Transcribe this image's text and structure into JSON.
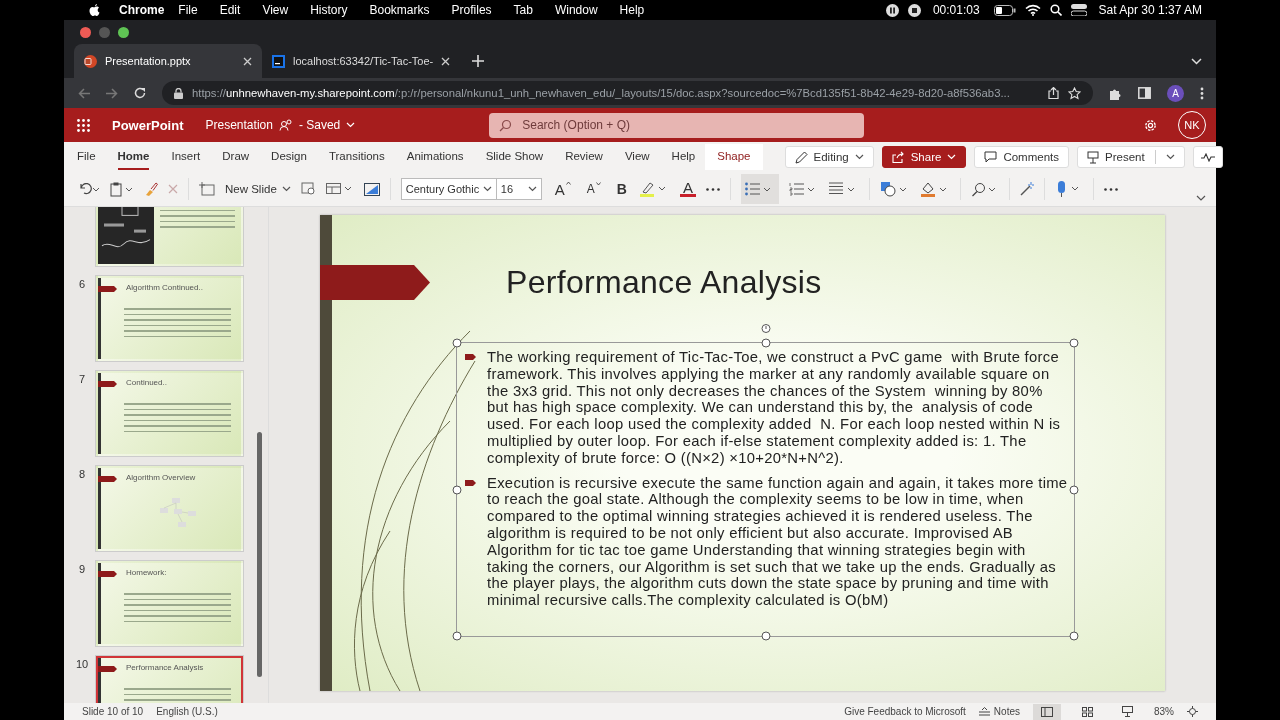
{
  "menubar": {
    "app": "Chrome",
    "menus": [
      "File",
      "Edit",
      "View",
      "History",
      "Bookmarks",
      "Profiles",
      "Tab",
      "Window",
      "Help"
    ],
    "recording_time": "00:01:03",
    "datetime": "Sat Apr 30  1:37 AM"
  },
  "browser": {
    "tabs": [
      {
        "title": "Presentation.pptx",
        "selected": true
      },
      {
        "title": "localhost:63342/Tic-Tac-Toe-",
        "selected": false
      }
    ],
    "url_scheme": "https://",
    "url_domain": "unhnewhaven-my.sharepoint.com",
    "url_path": "/:p:/r/personal/nkunu1_unh_newhaven_edu/_layouts/15/doc.aspx?sourcedoc=%7Bcd135f51-8b42-4e29-8d20-a8f536ab3...",
    "profile": "A"
  },
  "app": {
    "name": "PowerPoint",
    "document": "Presentation",
    "save_status": "- Saved",
    "search": {
      "placeholder": "Search (Option + Q)"
    },
    "avatar": "NK"
  },
  "ribbon_tabs": [
    {
      "label": "File",
      "selected": false,
      "contextual": false
    },
    {
      "label": "Home",
      "selected": true,
      "contextual": false
    },
    {
      "label": "Insert",
      "selected": false,
      "contextual": false
    },
    {
      "label": "Draw",
      "selected": false,
      "contextual": false
    },
    {
      "label": "Design",
      "selected": false,
      "contextual": false
    },
    {
      "label": "Transitions",
      "selected": false,
      "contextual": false
    },
    {
      "label": "Animations",
      "selected": false,
      "contextual": false
    },
    {
      "label": "Slide Show",
      "selected": false,
      "contextual": false
    },
    {
      "label": "Review",
      "selected": false,
      "contextual": false
    },
    {
      "label": "View",
      "selected": false,
      "contextual": false
    },
    {
      "label": "Help",
      "selected": false,
      "contextual": false
    },
    {
      "label": "Shape",
      "selected": false,
      "contextual": true
    }
  ],
  "ribbon_actions": {
    "mode": "Editing",
    "share": "Share",
    "comments": "Comments",
    "present": "Present"
  },
  "toolbar": {
    "new_slide": "New Slide",
    "font": "Century Gothic",
    "font_size": "16",
    "grow_font": "A",
    "shrink_font": "A",
    "bold": "B",
    "font_color": "A"
  },
  "thumbnails": [
    {
      "kind": "picture",
      "selected": false
    },
    {
      "kind": "text",
      "number": "6",
      "title": "Algorithm Continued..",
      "selected": false
    },
    {
      "kind": "text",
      "number": "7",
      "title": "Continued..",
      "selected": false
    },
    {
      "kind": "diagram",
      "number": "8",
      "title": "Algorithm Overview",
      "selected": false
    },
    {
      "kind": "text",
      "number": "9",
      "title": "Homework:",
      "selected": false
    },
    {
      "kind": "text",
      "number": "10",
      "title": "Performance Analysis",
      "selected": true
    }
  ],
  "slide": {
    "title": "Performance Analysis",
    "bullets": [
      "The working requirement of Tic-Tac-Toe, we construct a PvC game  with Brute force framework. This involves applying the marker at any randomly available square on the 3x3 grid. This not only decreases the chances of the System  winning by 80% but has high space complexity. We can understand this by, the  analysis of code used. For each loop used the complexity added  N. For each loop nested within N is multiplied by outer loop. For each if-else statement complexity added is: 1. The complexity of brute force: O ((N×2) ×10+20*N+N^2).",
      "Execution is recursive execute the same function again and again, it takes more time to reach the goal state. Although the complexity seems to be low in time, when compared to the optimal winning strategies achieved it is rendered useless. The algorithm is required to be not only efficient but also accurate. Improvised AB Algorithm for tic tac toe game Understanding that winning strategies begin with taking the corners, our Algorithm is set such that we take up the ends. Gradually as the player plays, the algorithm cuts down the state space by pruning and time with minimal recursive calls.The complexity calculated is O(bM)"
    ]
  },
  "status_bar": {
    "slide_info": "Slide 10 of 10",
    "language": "English (U.S.)",
    "feedback": "Give Feedback to Microsoft",
    "notes": "Notes",
    "zoom": "83%"
  }
}
